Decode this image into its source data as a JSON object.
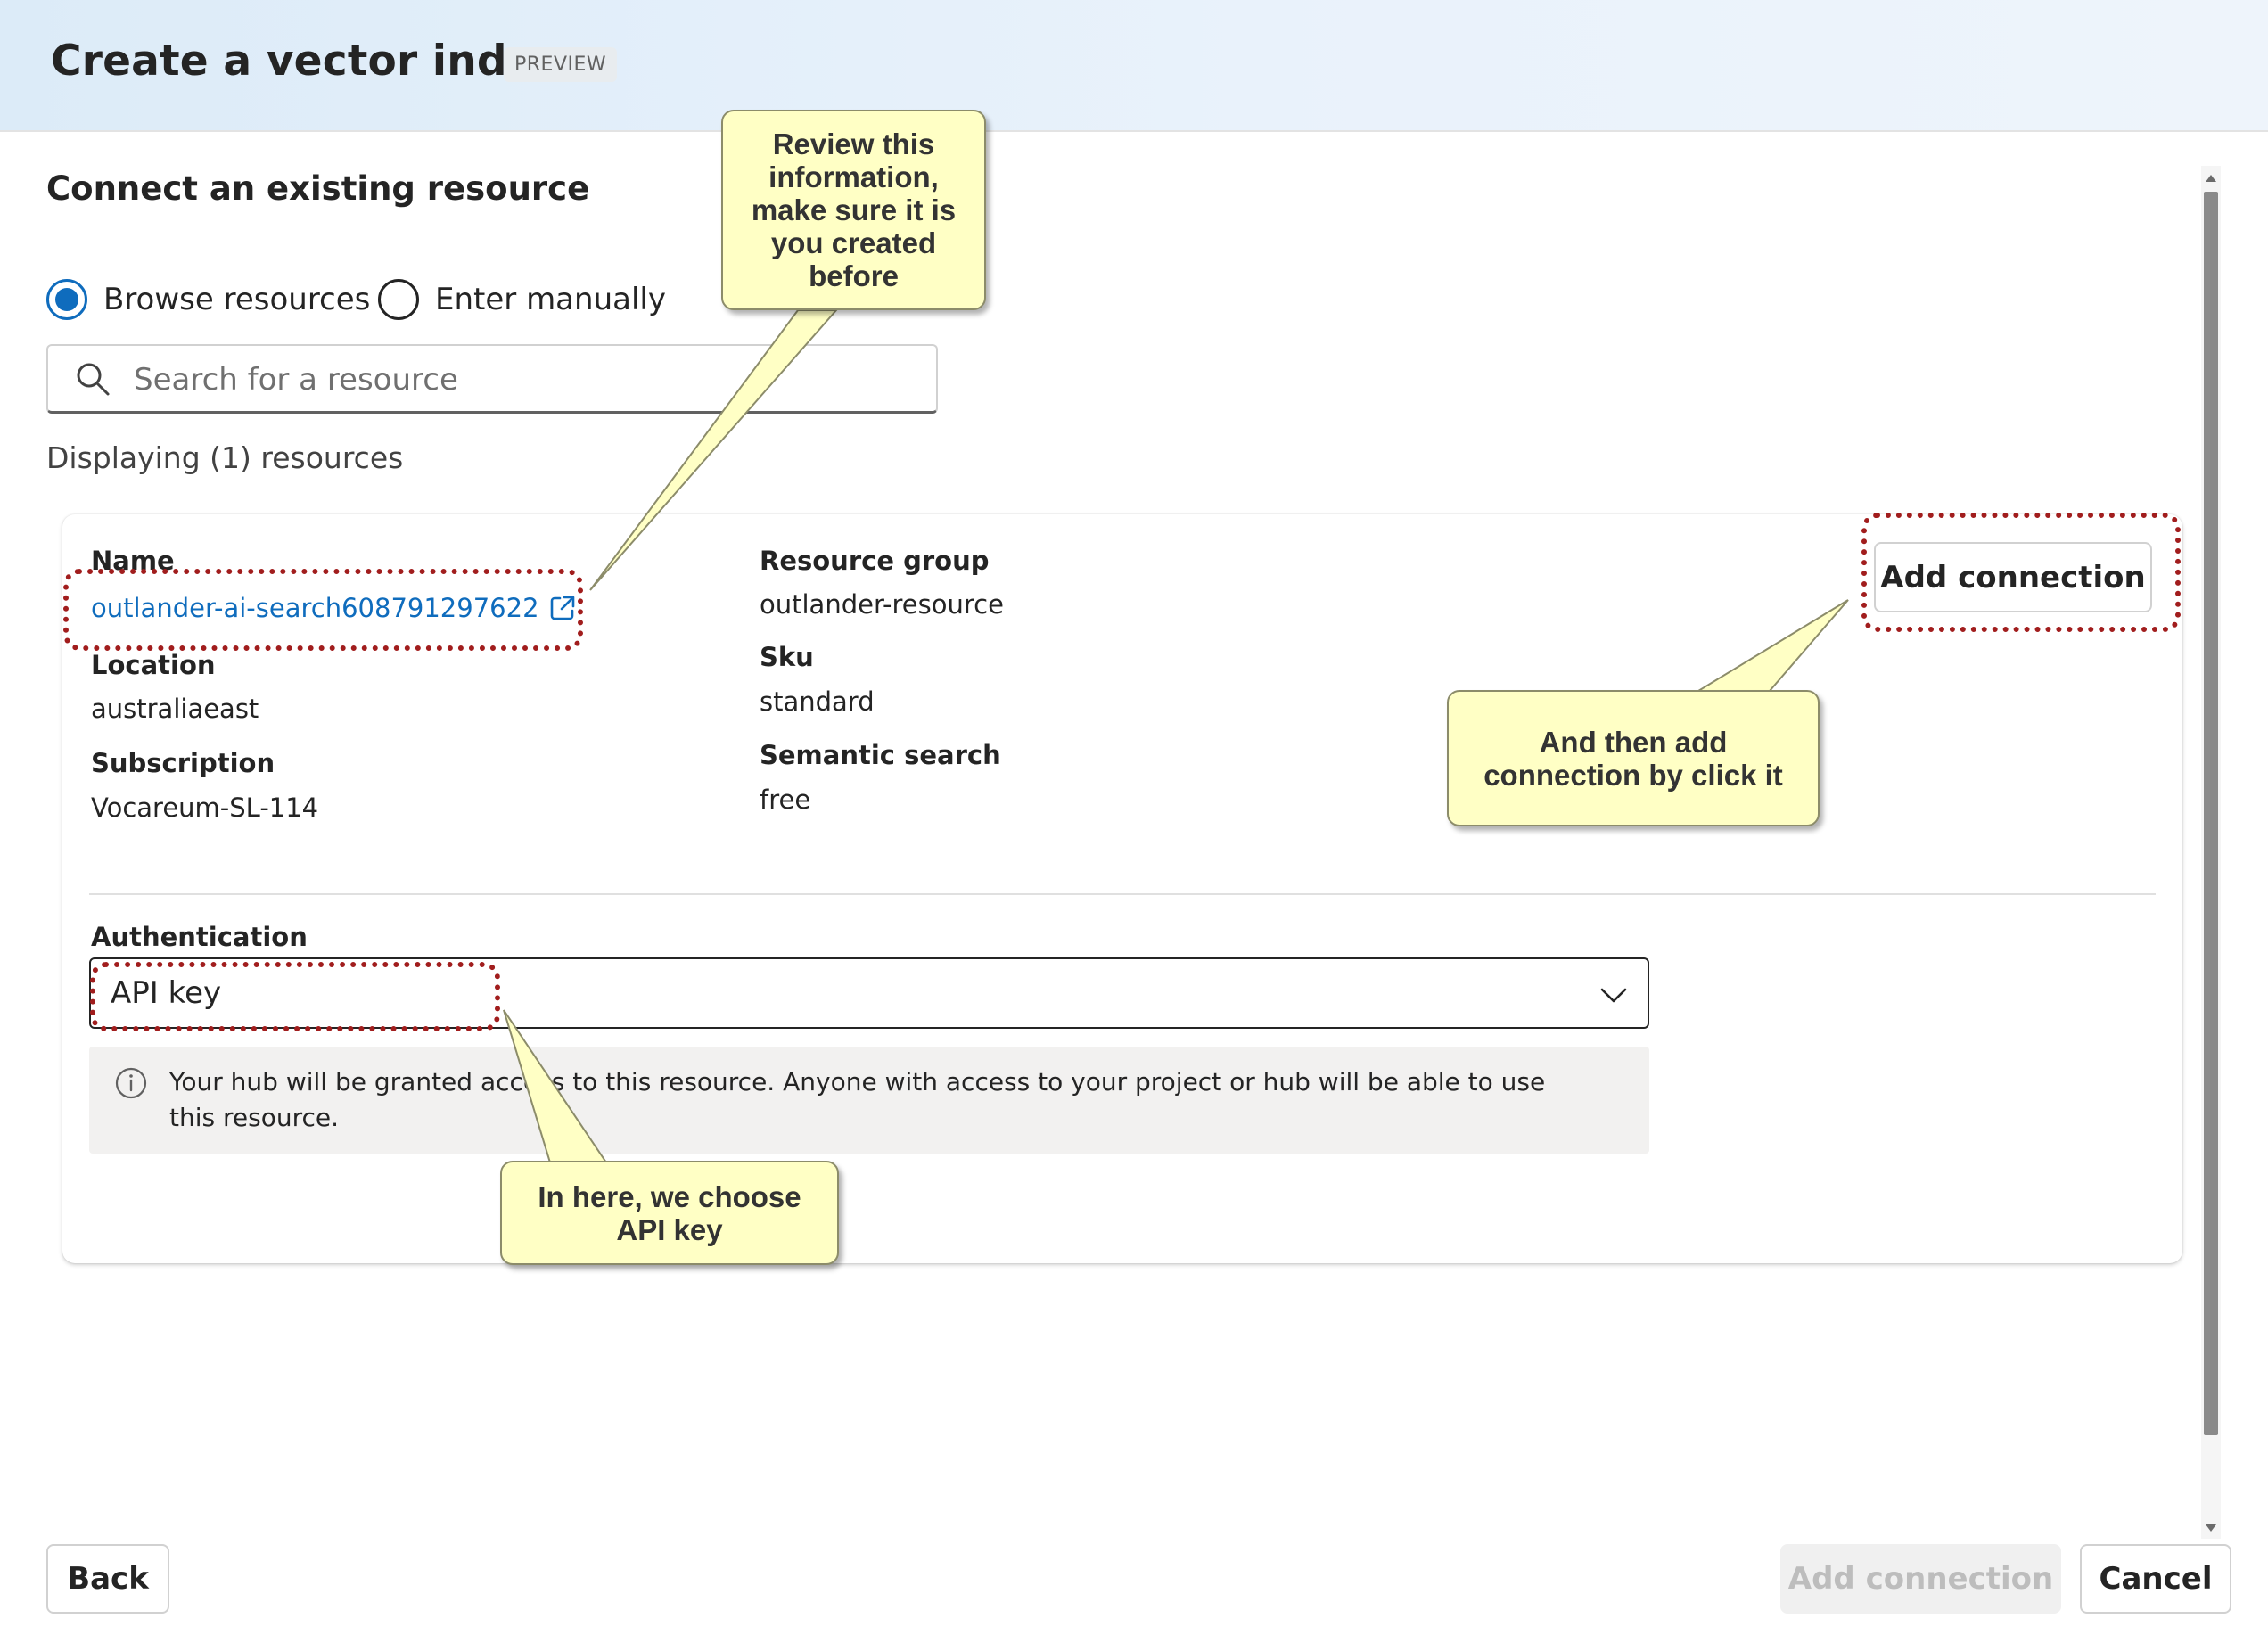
{
  "header": {
    "title": "Create a vector index",
    "badge": "PREVIEW"
  },
  "section": {
    "title": "Connect an existing resource"
  },
  "mode": {
    "options": [
      {
        "label": "Browse resources",
        "checked": true
      },
      {
        "label": "Enter manually",
        "checked": false
      }
    ]
  },
  "search": {
    "placeholder": "Search for a resource",
    "value": ""
  },
  "results_count_text": "Displaying (1) resources",
  "resource": {
    "name_label": "Name",
    "name": "outlander-ai-search608791297622",
    "location_label": "Location",
    "location": "australiaeast",
    "subscription_label": "Subscription",
    "subscription": "Vocareum-SL-114",
    "resource_group_label": "Resource group",
    "resource_group": "outlander-resource",
    "sku_label": "Sku",
    "sku": "standard",
    "semantic_label": "Semantic search",
    "semantic": "free",
    "add_connection_label": "Add connection",
    "auth_label": "Authentication",
    "auth_value": "API key",
    "info_text": "Your hub will be granted access to this resource. Anyone with access to your project or hub will be able to use this resource."
  },
  "footer": {
    "back": "Back",
    "add_connection": "Add connection",
    "cancel": "Cancel"
  },
  "annotations": {
    "review": "Review this information, make sure it is you created before",
    "add": "And then add connection by click it",
    "api": "In here, we choose API key"
  },
  "colors": {
    "accent": "#0f6cbd",
    "callout": "#ffffc5",
    "highlight": "#a11d1d"
  }
}
